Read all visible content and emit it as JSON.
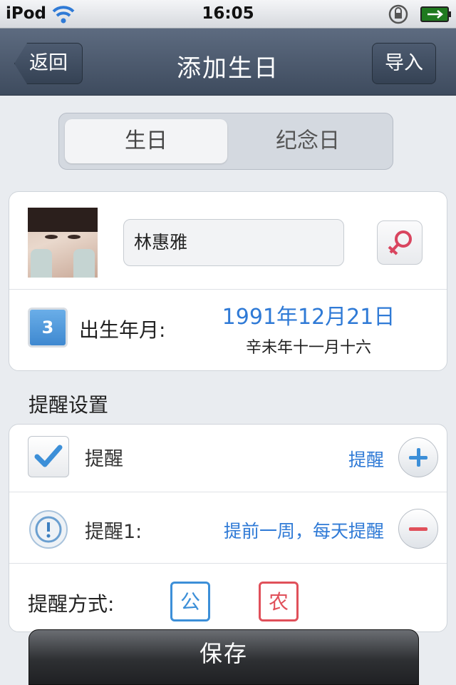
{
  "status_bar": {
    "carrier": "iPod",
    "time": "16:05",
    "wifi_icon": "wifi-icon",
    "lock_icon": "rotation-lock-icon",
    "battery_icon": "battery-charging-icon"
  },
  "nav": {
    "back_label": "返回",
    "title": "添加生日",
    "right_label": "导入"
  },
  "segment": {
    "tabs": [
      {
        "label": "生日",
        "selected": true
      },
      {
        "label": "纪念日",
        "selected": false
      }
    ]
  },
  "profile": {
    "name_value": "林惠雅",
    "gender_icon": "female-symbol-icon",
    "gender_color": "#d9455f",
    "calendar_day": "3",
    "birth_label": "出生年月:",
    "birth_date": "1991年12月21日",
    "birth_lunar": "辛未年十一月十六"
  },
  "reminders": {
    "section_title": "提醒设置",
    "reminder_label": "提醒",
    "reminder_value": "提醒",
    "reminder1_label": "提醒1:",
    "reminder1_value": "提前一周，每天提醒",
    "method_label": "提醒方式:",
    "solar_badge": "公",
    "lunar_badge": "农",
    "solar_color": "#3c8fd8",
    "lunar_color": "#e0505a",
    "accent_color": "#2f7ad6"
  },
  "save_button": {
    "label": "保存"
  }
}
